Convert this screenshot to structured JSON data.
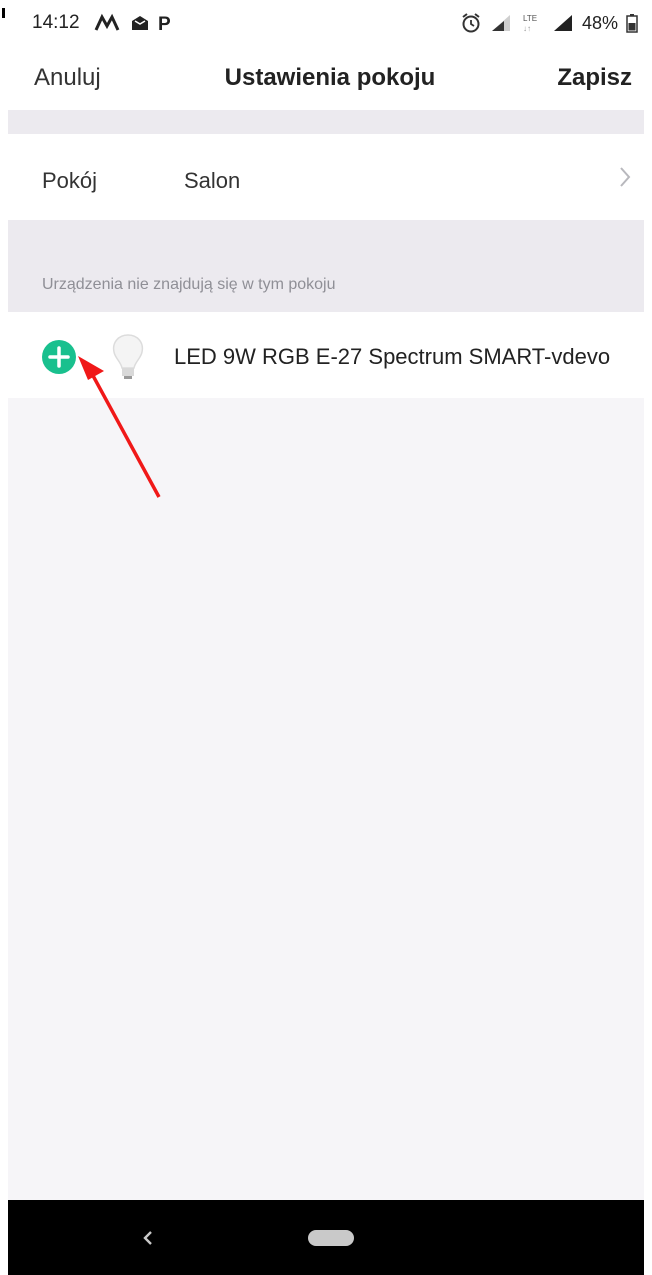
{
  "status_bar": {
    "time": "14:12",
    "notification_icons": "M  P",
    "battery_percent": "48%"
  },
  "header": {
    "cancel_label": "Anuluj",
    "title": "Ustawienia pokoju",
    "save_label": "Zapisz"
  },
  "room": {
    "label": "Pokój",
    "value": "Salon"
  },
  "section": {
    "title": "Urządzenia nie znajdują się w tym pokoju"
  },
  "devices": [
    {
      "name": "LED 9W RGB E-27 Spectrum SMART-vdevo",
      "icon": "bulb-icon"
    }
  ],
  "colors": {
    "accent": "#19c08e",
    "annotation": "#f01818",
    "background": "#f6f5f8",
    "nav_bar": "#000000"
  }
}
